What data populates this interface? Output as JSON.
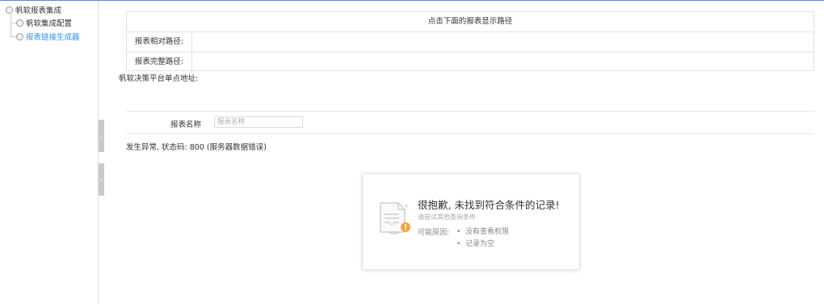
{
  "sidebar": {
    "root": {
      "label": "帆软报表集成"
    },
    "items": [
      {
        "label": "帆软集成配置",
        "active": false
      },
      {
        "label": "报表链接生成器",
        "active": true
      }
    ]
  },
  "path_panel": {
    "title": "点击下面的报表显示路径",
    "rows": [
      {
        "label": "报表相对路径:",
        "value": ""
      },
      {
        "label": "报表完整路径:",
        "value": ""
      }
    ]
  },
  "sso": {
    "label": "帆软决策平台单点地址:"
  },
  "search": {
    "label": "报表名称",
    "placeholder": "报表名称",
    "value": ""
  },
  "error": {
    "message": "发生异常, 状态码: 800 (服务器数据错误)"
  },
  "empty_state": {
    "title": "很抱歉, 未找到符合条件的记录!",
    "subtitle": "请尝试其他查询条件",
    "reasons_label": "可能原因:",
    "reasons": [
      "没有查看权限",
      "记录为空"
    ]
  },
  "collapse": {
    "tab1_icon": "chevron-right-icon",
    "tab2_icon": "chevron-left-icon"
  },
  "colors": {
    "accent": "#3a8ee6",
    "warning": "#f4a340"
  }
}
